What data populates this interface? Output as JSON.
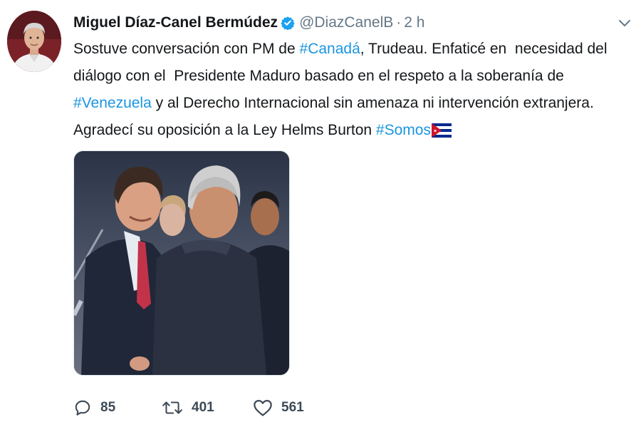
{
  "tweet": {
    "display_name": "Miguel Díaz-Canel Bermúdez",
    "handle": "@DiazCanelB",
    "separator": "·",
    "time": "2 h",
    "verified_icon": "verified-badge-icon",
    "menu_icon": "chevron-down-icon",
    "text_segments": [
      {
        "type": "text",
        "value": "Sostuve conversación con PM de "
      },
      {
        "type": "hashtag",
        "value": "#Canadá"
      },
      {
        "type": "text",
        "value": ", Trudeau. Enfaticé en  necesidad del\ndiálogo con el  Presidente Maduro basado en el respeto a la soberanía de\n"
      },
      {
        "type": "hashtag",
        "value": "#Venezuela"
      },
      {
        "type": "text",
        "value": " y al Derecho Internacional sin amenaza ni intervención extranjera.\nAgradecí su oposición a la Ley Helms Burton "
      },
      {
        "type": "hashtag",
        "value": "#Somos"
      }
    ],
    "emoji": "cuba-flag-icon",
    "photo": "photo-two-leaders-handshake",
    "actions": {
      "reply_count": "85",
      "retweet_count": "401",
      "like_count": "561"
    }
  },
  "colors": {
    "link": "#1b95e0",
    "verified": "#1da1f2",
    "muted": "#657786",
    "text": "#14171a"
  }
}
